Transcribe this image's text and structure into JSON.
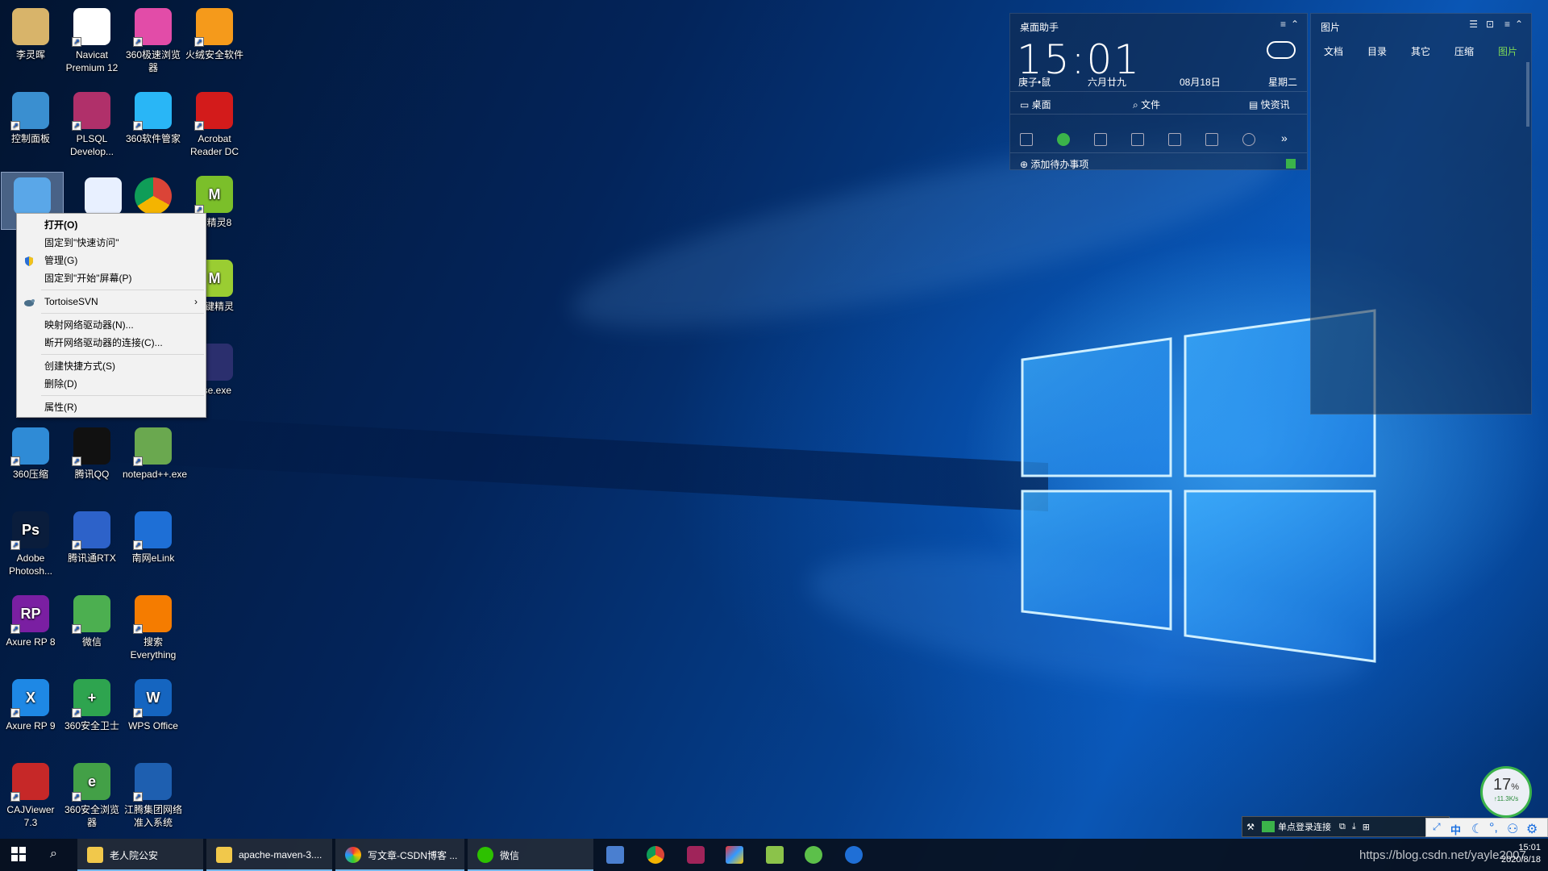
{
  "desktop_icons": [
    {
      "label": "李灵晖"
    },
    {
      "label": "Navicat Premium 12"
    },
    {
      "label": "360极速浏览器"
    },
    {
      "label": "火绒安全软件"
    },
    {
      "label": "控制面板"
    },
    {
      "label": "PLSQL Develop..."
    },
    {
      "label": "360软件管家"
    },
    {
      "label": "Acrobat Reader DC"
    },
    {
      "label": "键精灵8"
    },
    {
      "label": "按键精灵"
    },
    {
      "label": "pse.exe"
    },
    {
      "label": "360压缩"
    },
    {
      "label": "腾讯QQ"
    },
    {
      "label": "notepad++.exe"
    },
    {
      "label": "Adobe Photosh..."
    },
    {
      "label": "腾讯通RTX"
    },
    {
      "label": "南网eLink"
    },
    {
      "label": "Axure RP 8"
    },
    {
      "label": "微信"
    },
    {
      "label": "搜索 Everything"
    },
    {
      "label": "Axure RP 9"
    },
    {
      "label": "360安全卫士"
    },
    {
      "label": "WPS Office"
    },
    {
      "label": "CAJViewer 7.3"
    },
    {
      "label": "360安全浏览器"
    },
    {
      "label": "江腾集团网络准入系统"
    }
  ],
  "context_menu": {
    "items": [
      {
        "label": "打开(O)"
      },
      {
        "label": "固定到\"快速访问\""
      },
      {
        "label": "管理(G)"
      },
      {
        "label": "固定到\"开始\"屏幕(P)"
      },
      {
        "label": "TortoiseSVN"
      },
      {
        "label": "映射网络驱动器(N)..."
      },
      {
        "label": "断开网络驱动器的连接(C)..."
      },
      {
        "label": "创建快捷方式(S)"
      },
      {
        "label": "删除(D)"
      },
      {
        "label": "属性(R)"
      }
    ],
    "submenu_arrow": "›"
  },
  "widget_assistant": {
    "title": "桌面助手",
    "time": "15:01",
    "lunar_year": "庚子•鼠",
    "lunar_date": "六月廿九",
    "date": "08月18日",
    "weekday": "星期二",
    "links": [
      "桌面",
      "文件",
      "快资讯"
    ],
    "add_todo": "添加待办事项"
  },
  "widget_images": {
    "title": "图片",
    "tabs": [
      "文档",
      "目录",
      "其它",
      "压缩",
      "图片"
    ],
    "active_tab": "图片"
  },
  "taskbar": {
    "items": [
      "老人院公安",
      "apache-maven-3....",
      "写文章-CSDN博客 ...",
      "微信"
    ],
    "clock_time": "15:01",
    "clock_date": "2020/8/18"
  },
  "tray": {
    "notify_text": "单点登录连接",
    "ime": "中"
  },
  "speed_widget": {
    "percent": "17",
    "unit": "%",
    "rate": "↑11.3K/s"
  },
  "watermark": "https://blog.csdn.net/yayle2007",
  "colors": {
    "accent": "#3bb34a",
    "menu_bg": "#f2f2f2",
    "taskbar": "#08101e"
  }
}
